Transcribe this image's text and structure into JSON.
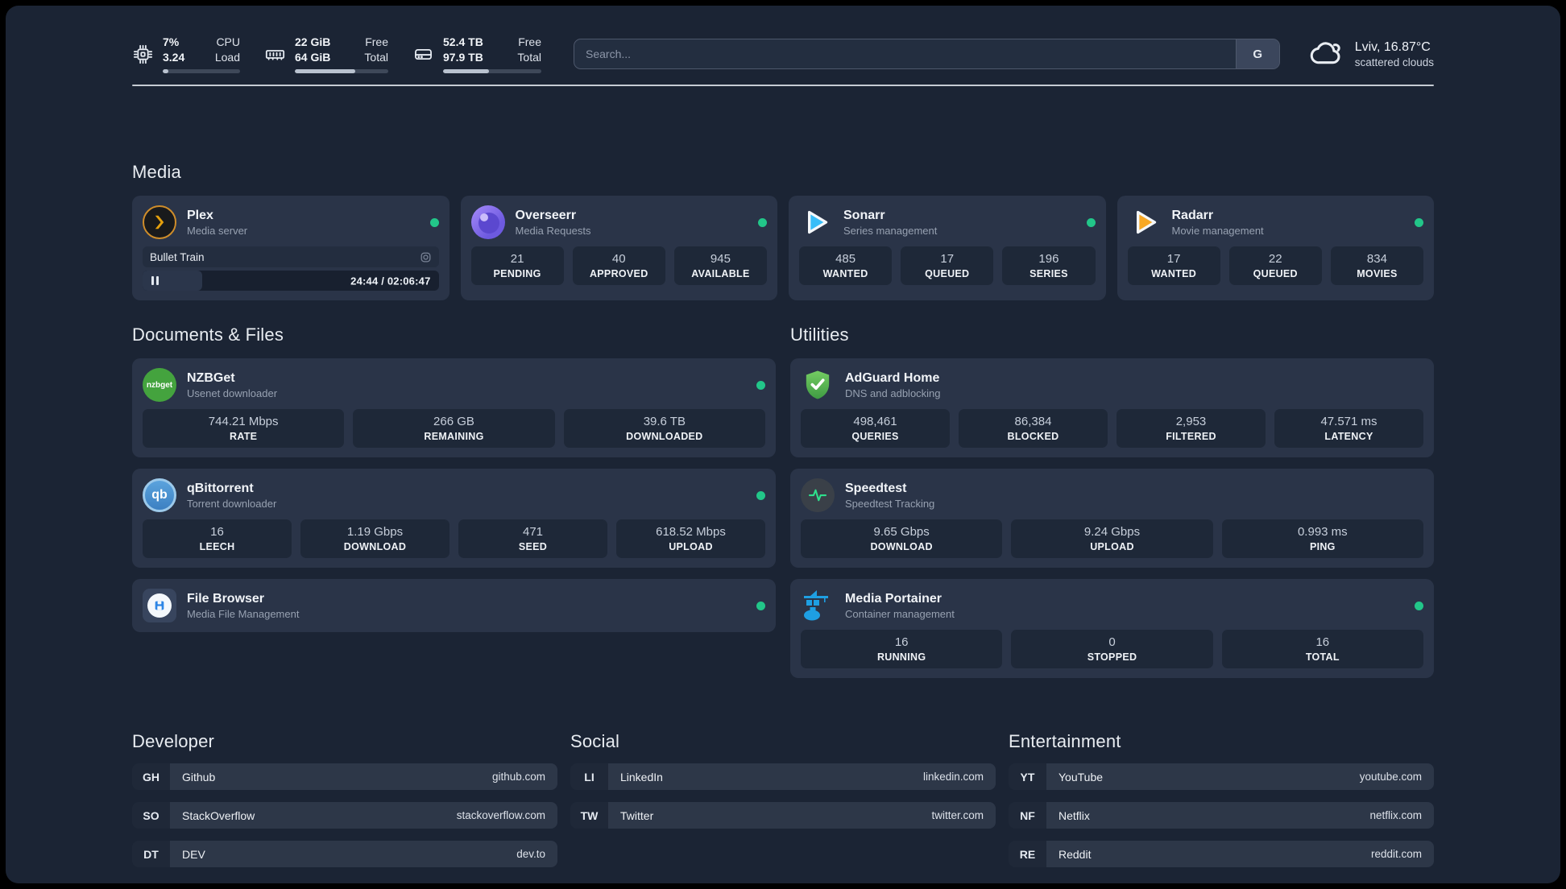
{
  "header": {
    "system_stats": [
      {
        "name": "cpu",
        "value_top": "7%",
        "value_bottom": "3.24",
        "label_top": "CPU",
        "label_bottom": "Load",
        "progress_pct": 7
      },
      {
        "name": "memory",
        "value_top": "22 GiB",
        "value_bottom": "64 GiB",
        "label_top": "Free",
        "label_bottom": "Total",
        "progress_pct": 65
      },
      {
        "name": "storage",
        "value_top": "52.4 TB",
        "value_bottom": "97.9 TB",
        "label_top": "Free",
        "label_bottom": "Total",
        "progress_pct": 47
      }
    ],
    "search": {
      "placeholder": "Search...",
      "engine_button": "G"
    },
    "weather": {
      "location": "Lviv, 16.87°C",
      "condition": "scattered clouds"
    }
  },
  "media": {
    "heading": "Media",
    "plex": {
      "name": "Plex",
      "description": "Media server",
      "now_playing": {
        "title": "Bullet Train",
        "time": "24:44 / 02:06:47",
        "progress_pct": 20
      }
    },
    "overseerr": {
      "name": "Overseerr",
      "description": "Media Requests",
      "stats": [
        {
          "value": "21",
          "label": "PENDING"
        },
        {
          "value": "40",
          "label": "APPROVED"
        },
        {
          "value": "945",
          "label": "AVAILABLE"
        }
      ]
    },
    "sonarr": {
      "name": "Sonarr",
      "description": "Series management",
      "stats": [
        {
          "value": "485",
          "label": "WANTED"
        },
        {
          "value": "17",
          "label": "QUEUED"
        },
        {
          "value": "196",
          "label": "SERIES"
        }
      ]
    },
    "radarr": {
      "name": "Radarr",
      "description": "Movie management",
      "stats": [
        {
          "value": "17",
          "label": "WANTED"
        },
        {
          "value": "22",
          "label": "QUEUED"
        },
        {
          "value": "834",
          "label": "MOVIES"
        }
      ]
    }
  },
  "documents": {
    "heading": "Documents & Files",
    "nzbget": {
      "name": "NZBGet",
      "description": "Usenet downloader",
      "logo_text": "nzbget",
      "stats": [
        {
          "value": "744.21 Mbps",
          "label": "RATE"
        },
        {
          "value": "266 GB",
          "label": "REMAINING"
        },
        {
          "value": "39.6 TB",
          "label": "DOWNLOADED"
        }
      ]
    },
    "qbittorrent": {
      "name": "qBittorrent",
      "description": "Torrent downloader",
      "logo_text": "qb",
      "stats": [
        {
          "value": "16",
          "label": "LEECH"
        },
        {
          "value": "1.19 Gbps",
          "label": "DOWNLOAD"
        },
        {
          "value": "471",
          "label": "SEED"
        },
        {
          "value": "618.52 Mbps",
          "label": "UPLOAD"
        }
      ]
    },
    "filebrowser": {
      "name": "File Browser",
      "description": "Media File Management"
    }
  },
  "utilities": {
    "heading": "Utilities",
    "adguard": {
      "name": "AdGuard Home",
      "description": "DNS and adblocking",
      "stats": [
        {
          "value": "498,461",
          "label": "QUERIES"
        },
        {
          "value": "86,384",
          "label": "BLOCKED"
        },
        {
          "value": "2,953",
          "label": "FILTERED"
        },
        {
          "value": "47.571 ms",
          "label": "LATENCY"
        }
      ]
    },
    "speedtest": {
      "name": "Speedtest",
      "description": "Speedtest Tracking",
      "stats": [
        {
          "value": "9.65 Gbps",
          "label": "DOWNLOAD"
        },
        {
          "value": "9.24 Gbps",
          "label": "UPLOAD"
        },
        {
          "value": "0.993 ms",
          "label": "PING"
        }
      ]
    },
    "portainer": {
      "name": "Media Portainer",
      "description": "Container management",
      "stats": [
        {
          "value": "16",
          "label": "RUNNING"
        },
        {
          "value": "0",
          "label": "STOPPED"
        },
        {
          "value": "16",
          "label": "TOTAL"
        }
      ]
    }
  },
  "bookmarks": {
    "developer": {
      "heading": "Developer",
      "items": [
        {
          "abbr": "GH",
          "name": "Github",
          "url": "github.com"
        },
        {
          "abbr": "SO",
          "name": "StackOverflow",
          "url": "stackoverflow.com"
        },
        {
          "abbr": "DT",
          "name": "DEV",
          "url": "dev.to"
        }
      ]
    },
    "social": {
      "heading": "Social",
      "items": [
        {
          "abbr": "LI",
          "name": "LinkedIn",
          "url": "linkedin.com"
        },
        {
          "abbr": "TW",
          "name": "Twitter",
          "url": "twitter.com"
        }
      ]
    },
    "entertainment": {
      "heading": "Entertainment",
      "items": [
        {
          "abbr": "YT",
          "name": "YouTube",
          "url": "youtube.com"
        },
        {
          "abbr": "NF",
          "name": "Netflix",
          "url": "netflix.com"
        },
        {
          "abbr": "RE",
          "name": "Reddit",
          "url": "reddit.com"
        }
      ]
    }
  },
  "colors": {
    "status_online": "#22c689",
    "plex_accent": "#e5a00d",
    "sonarr_accent": "#38bdf8",
    "radarr_accent": "#f7a825",
    "adguard_accent": "#57b14f",
    "portainer_accent": "#1e9fe3"
  }
}
